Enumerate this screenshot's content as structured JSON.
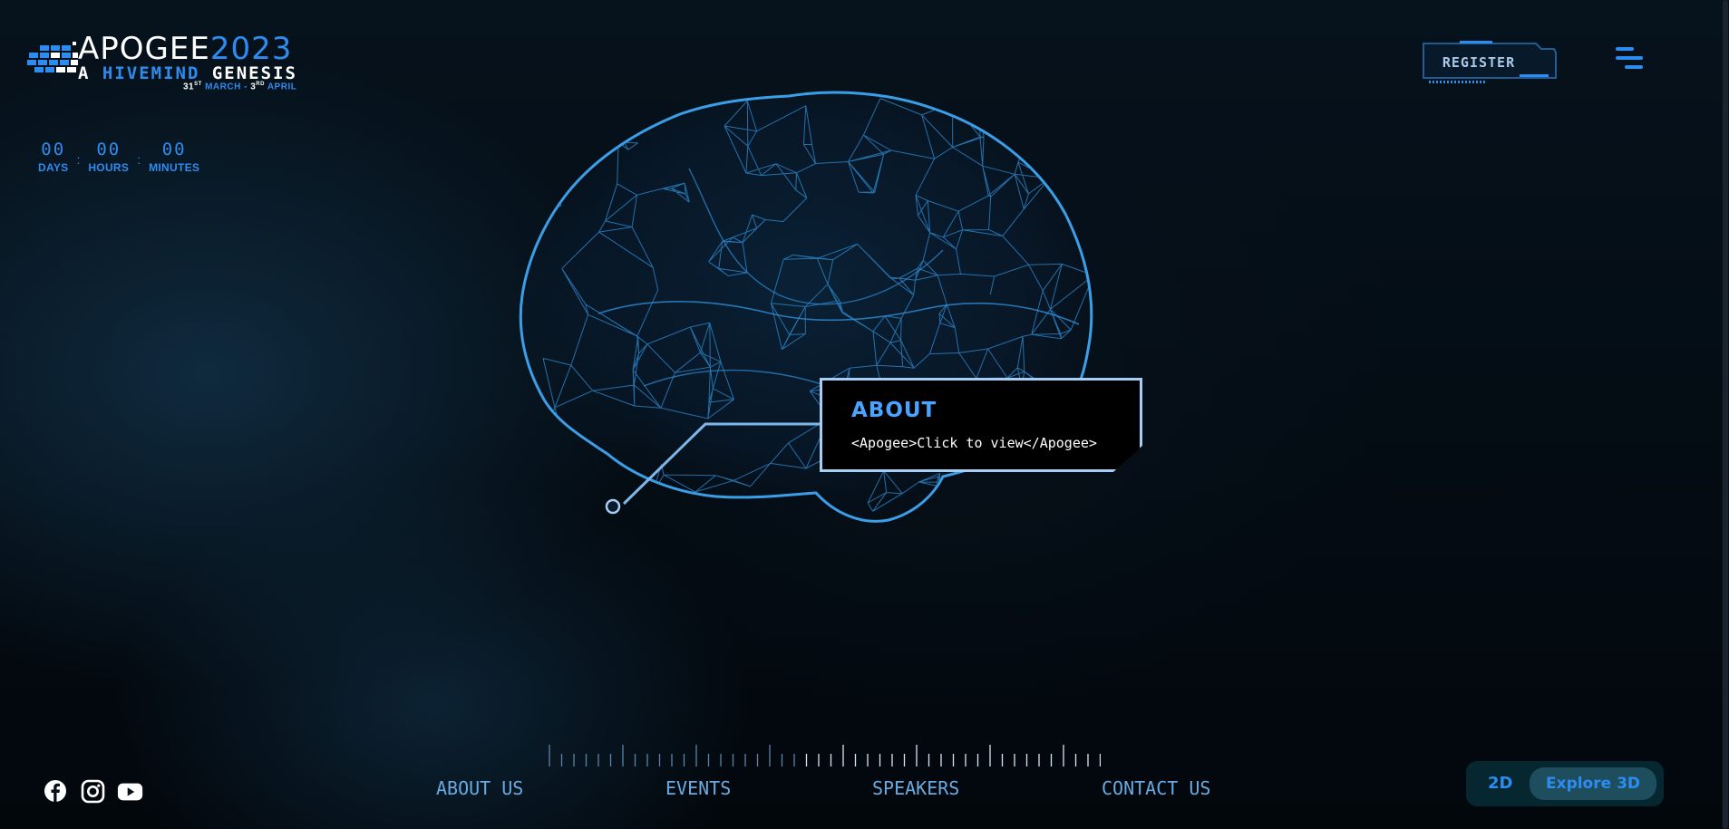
{
  "logo": {
    "title_part1": "APOGEE",
    "title_part2": "2023",
    "subtitle_part1": "A ",
    "subtitle_part2": "HIVEMIND",
    "subtitle_part3": " GENESIS",
    "dates": "31ST MARCH - 3RD APRIL",
    "date_start_day": "31",
    "date_start_suffix": "ST",
    "date_start_month": " MARCH - ",
    "date_end_day": "3",
    "date_end_suffix": "RD",
    "date_end_month": " APRIL"
  },
  "countdown": {
    "days": {
      "value": "00",
      "label": "DAYS"
    },
    "hours": {
      "value": "00",
      "label": "HOURS"
    },
    "minutes": {
      "value": "00",
      "label": "MINUTES"
    },
    "separator": ":"
  },
  "header": {
    "register_label": "REGISTER",
    "menu_icon": "hamburger-menu-icon"
  },
  "about_callout": {
    "title": "ABOUT",
    "text": "<Apogee>Click to view</Apogee>"
  },
  "nav": {
    "items": [
      {
        "label": "ABOUT US"
      },
      {
        "label": "EVENTS"
      },
      {
        "label": "SPEAKERS"
      },
      {
        "label": "CONTACT US"
      }
    ]
  },
  "social": [
    {
      "name": "facebook-icon"
    },
    {
      "name": "instagram-icon"
    },
    {
      "name": "youtube-icon"
    }
  ],
  "view_toggle": {
    "option_2d": "2D",
    "option_3d": "Explore 3D",
    "selected": "Explore 3D"
  },
  "colors": {
    "accent": "#2d8cf0",
    "nav_text": "#6aaae0",
    "brain_wire": "#2f8fd8",
    "background": "#03080d"
  }
}
